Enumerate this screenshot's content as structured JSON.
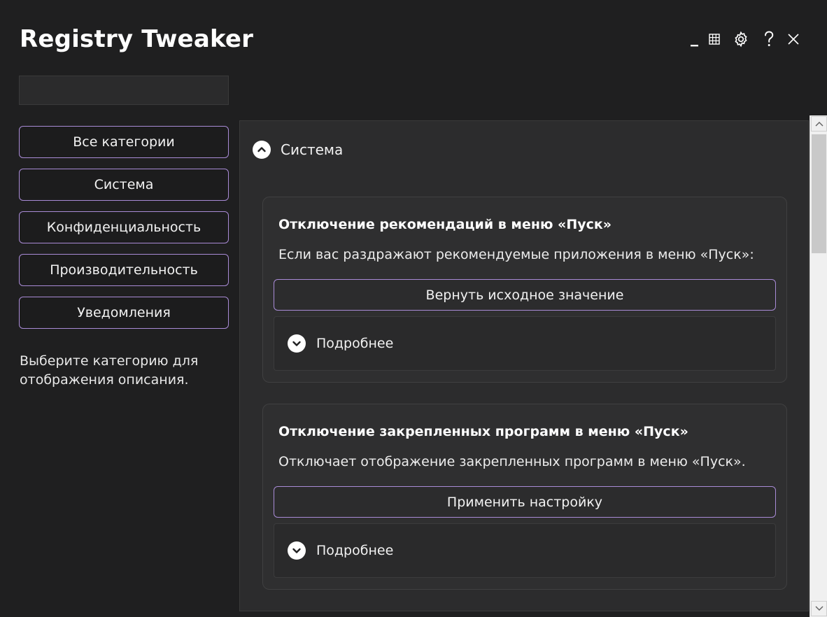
{
  "app": {
    "title": "Registry Tweaker"
  },
  "titlebar": {
    "minimize": "minimize-icon",
    "layout": "grid-icon",
    "settings": "gear-icon",
    "help": "help-icon",
    "close": "close-icon"
  },
  "search": {
    "value": "",
    "placeholder": ""
  },
  "sidebar": {
    "categories": [
      {
        "label": "Все категории"
      },
      {
        "label": "Система"
      },
      {
        "label": "Конфиденциальность"
      },
      {
        "label": "Производительность"
      },
      {
        "label": "Уведомления"
      }
    ],
    "hint": "Выберите категорию для отображения описания."
  },
  "section": {
    "title": "Система",
    "icon": "chevron-up-icon",
    "tweaks": [
      {
        "title": "Отключение рекомендаций в меню «Пуск»",
        "description": "Если вас раздражают рекомендуемые приложения в меню «Пуск»:",
        "action_label": "Вернуть исходное значение",
        "details_label": "Подробнее",
        "details_icon": "chevron-down-icon"
      },
      {
        "title": "Отключение закрепленных программ в меню «Пуск»",
        "description": "Отключает отображение закрепленных программ в меню «Пуск».",
        "action_label": "Применить настройку",
        "details_label": "Подробнее",
        "details_icon": "chevron-down-icon"
      }
    ]
  },
  "colors": {
    "background": "#1f1f20",
    "panel": "#2c2c2d",
    "accent_border": "#a98bd6",
    "text": "#ffffff"
  }
}
